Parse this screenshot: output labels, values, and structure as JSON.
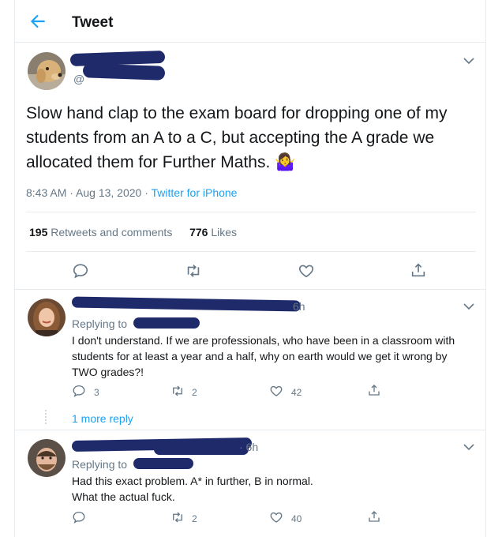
{
  "header": {
    "title": "Tweet"
  },
  "tweet": {
    "author_name": "",
    "handle_prefix": "@",
    "text": "Slow hand clap to the exam board for dropping one of my students from an A to a C, but accepting the A grade we allocated them for Further Maths. 🤷‍♀️",
    "time": "8:43 AM · Aug 13, 2020 ·",
    "source": "Twitter for iPhone",
    "retweets_count": "195",
    "retweets_label": "Retweets and comments",
    "likes_count": "776",
    "likes_label": "Likes"
  },
  "replies": [
    {
      "age": "6h",
      "replying_to": "Replying to",
      "text": "I don't understand. If we are professionals, who have been in a classroom with students for at least a year and a half, why on earth would we get it wrong by TWO grades?!",
      "comments": "3",
      "retweets": "2",
      "likes": "42",
      "more_replies": "1 more reply"
    },
    {
      "age": "· 6h",
      "replying_to": "Replying to",
      "text_line1": "Had this exact problem. A* in further, B in normal.",
      "text_line2": "What the actual fuck.",
      "retweets": "2",
      "likes": "40"
    }
  ],
  "icons": [
    "back-arrow-icon",
    "chevron-down-icon",
    "reply-icon",
    "retweet-icon",
    "like-icon",
    "share-icon"
  ],
  "colors": {
    "accent": "#1da1f2",
    "text": "#14171a",
    "muted": "#657786",
    "border": "#e6ecf0",
    "redaction": "#1f2a6b"
  }
}
